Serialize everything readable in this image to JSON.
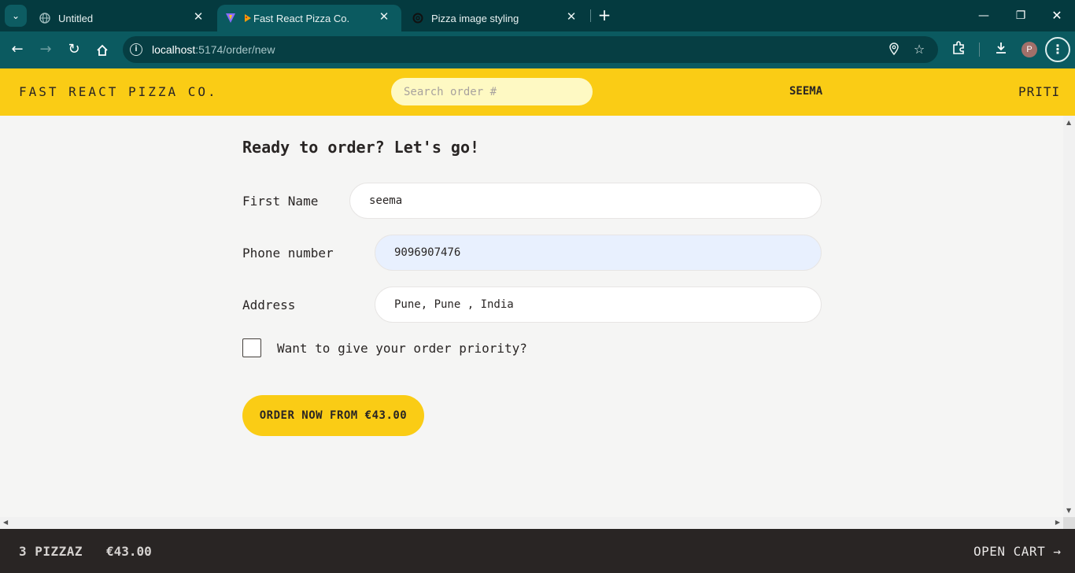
{
  "browser": {
    "tabs": [
      {
        "title": "Untitled"
      },
      {
        "title": "Fast React Pizza Co."
      },
      {
        "title": "Pizza image styling"
      }
    ],
    "url_host": "localhost",
    "url_path": ":5174/order/new",
    "avatar_initial": "P"
  },
  "header": {
    "logo": "FAST REACT PIZZA CO.",
    "search_placeholder": "Search order #",
    "username": "SEEMA",
    "username_right": "PRITI"
  },
  "form": {
    "title": "Ready to order? Let's go!",
    "first_name_label": "First Name",
    "first_name_value": "seema",
    "phone_label": "Phone number",
    "phone_value": "9096907476",
    "address_label": "Address",
    "address_value": "Pune, Pune , India",
    "priority_label": "Want to give your order priority?",
    "priority_checked": false,
    "submit_label": "ORDER NOW FROM €43.00"
  },
  "cart": {
    "count": "3 PIZZAZ",
    "total": "€43.00",
    "open_label": "OPEN CART →"
  },
  "colors": {
    "brand_yellow": "#facc15",
    "dark": "#292524",
    "chrome_teal": "#0b5a60"
  }
}
